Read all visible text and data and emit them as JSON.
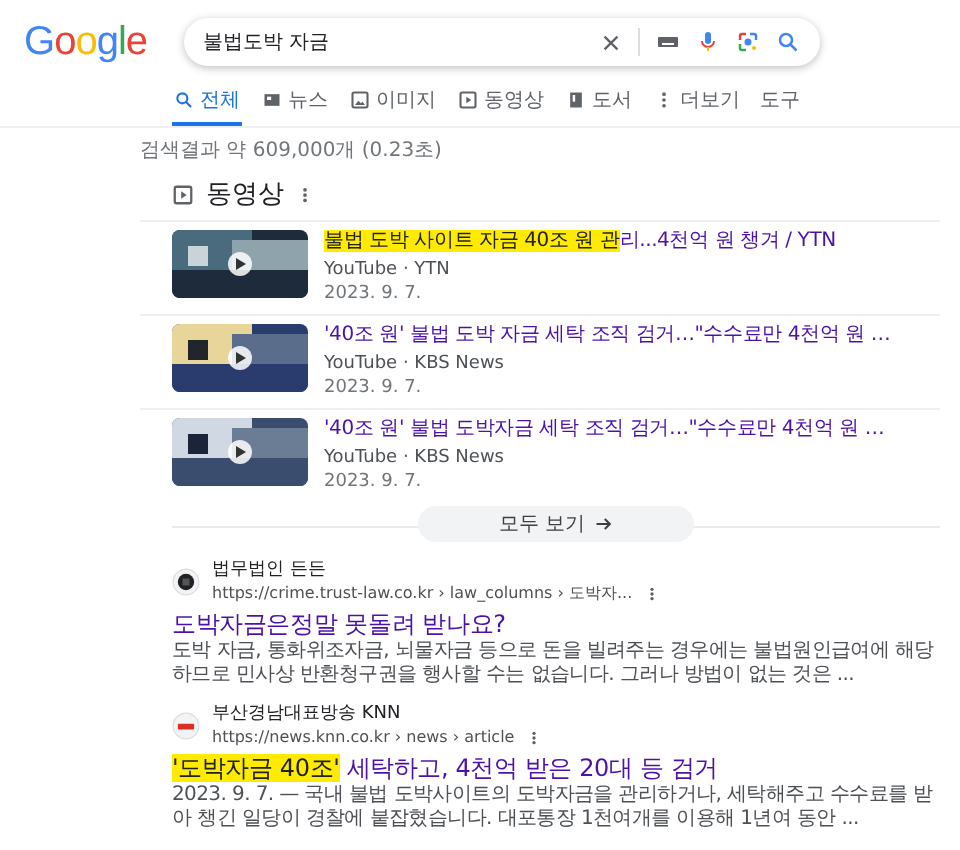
{
  "header": {
    "logo": "Google",
    "query": "불법도박 자금"
  },
  "tabs": [
    {
      "label": "전체",
      "selected": true
    },
    {
      "label": "뉴스",
      "selected": false
    },
    {
      "label": "이미지",
      "selected": false
    },
    {
      "label": "동영상",
      "selected": false
    },
    {
      "label": "도서",
      "selected": false
    },
    {
      "label": "더보기",
      "selected": false
    }
  ],
  "tools": "도구",
  "result_stats": "검색결과 약 609,000개 (0.23초)",
  "videos": {
    "heading": "동영상",
    "items": [
      {
        "title": [
          {
            "text": "불법 도박 사이트 자금 40조 원 관",
            "highlighted": true
          },
          {
            "text": "리...4천억 원 챙겨 / YTN",
            "highlighted": false
          }
        ],
        "source": "YouTube · YTN",
        "date": "2023. 9. 7."
      },
      {
        "title": [
          {
            "text": "'40조 원' 불법 도박 자금 세탁 조직 검거…\"수수료만 4천억 원 …",
            "highlighted": false
          }
        ],
        "source": "YouTube · KBS News",
        "date": "2023. 9. 7."
      },
      {
        "title": [
          {
            "text": "'40조 원' 불법 도박자금 세탁 조직 검거…\"수수료만 4천억 원 …",
            "highlighted": false
          }
        ],
        "source": "YouTube · KBS News",
        "date": "2023. 9. 7."
      }
    ],
    "more": "모두 보기"
  },
  "results": [
    {
      "site": "법무법인 든든",
      "url": "https://crime.trust-law.co.kr › law_columns › 도박자...",
      "title": [
        {
          "text": "도박자금은정말 못돌려 받나요?",
          "highlighted": false
        }
      ],
      "snippet": "도박 자금, 통화위조자금, 뇌물자금 등으로 돈을 빌려주는 경우에는 불법원인급여에 해당하므로 민사상 반환청구권을 행사할 수는 없습니다. 그러나 방법이 없는 것은 ..."
    },
    {
      "site": "부산경남대표방송 KNN",
      "url": "https://news.knn.co.kr › news › article",
      "title": [
        {
          "text": "'도박자금 40조'",
          "highlighted": true
        },
        {
          "text": " 세탁하고, 4천억 받은 20대 등 검거",
          "highlighted": false
        }
      ],
      "snippet": "2023. 9. 7. — 국내 불법 도박사이트의 도박자금을 관리하거나, 세탁해주고 수수료를 받아 챙긴 일당이 경찰에 붙잡혔습니다. 대포통장 1천여개를 이용해 1년여 동안 ..."
    }
  ]
}
